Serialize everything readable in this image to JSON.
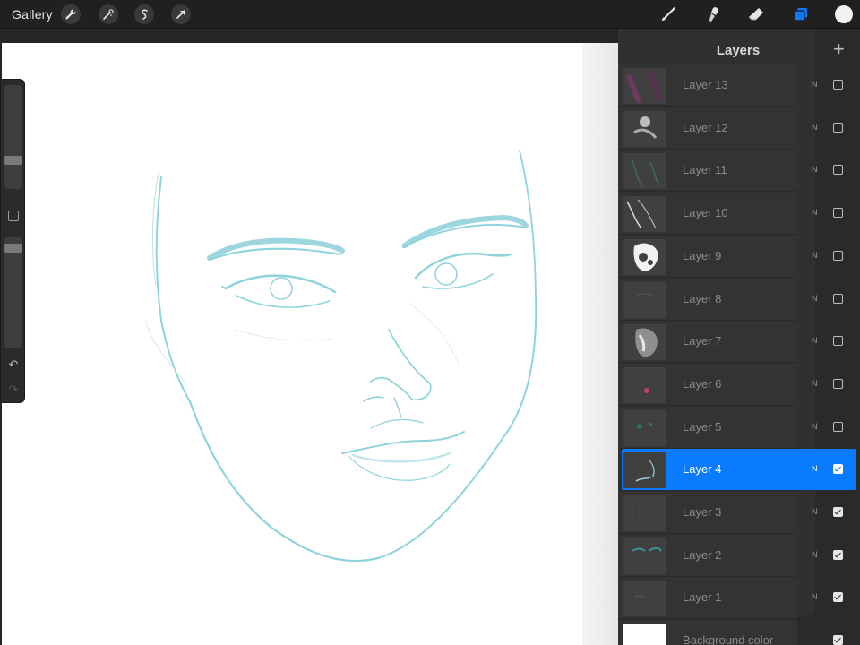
{
  "toolbar": {
    "gallery_label": "Gallery",
    "left_tools": [
      {
        "name": "actions-wrench-icon"
      },
      {
        "name": "adjustments-wand-icon"
      },
      {
        "name": "selection-icon"
      },
      {
        "name": "transform-arrow-icon"
      }
    ],
    "right_tools": [
      {
        "name": "brush-icon"
      },
      {
        "name": "smudge-icon"
      },
      {
        "name": "eraser-icon"
      },
      {
        "name": "layers-icon",
        "active": true,
        "color": "#0a7aff"
      }
    ],
    "current_color": "#f2f2f2"
  },
  "sidebar": {
    "undo_icon": "↶",
    "redo_icon": "↷"
  },
  "layers": {
    "title": "Layers",
    "add_icon": "+",
    "items": [
      {
        "name": "Layer 13",
        "blend": "N",
        "visible": false,
        "selected": false
      },
      {
        "name": "Layer 12",
        "blend": "N",
        "visible": false,
        "selected": false
      },
      {
        "name": "Layer 11",
        "blend": "N",
        "visible": false,
        "selected": false
      },
      {
        "name": "Layer 10",
        "blend": "N",
        "visible": false,
        "selected": false
      },
      {
        "name": "Layer 9",
        "blend": "N",
        "visible": false,
        "selected": false
      },
      {
        "name": "Layer 8",
        "blend": "N",
        "visible": false,
        "selected": false
      },
      {
        "name": "Layer 7",
        "blend": "N",
        "visible": false,
        "selected": false
      },
      {
        "name": "Layer 6",
        "blend": "N",
        "visible": false,
        "selected": false
      },
      {
        "name": "Layer 5",
        "blend": "N",
        "visible": false,
        "selected": false
      },
      {
        "name": "Layer 4",
        "blend": "N",
        "visible": true,
        "selected": true
      },
      {
        "name": "Layer 3",
        "blend": "N",
        "visible": true,
        "selected": false
      },
      {
        "name": "Layer 2",
        "blend": "N",
        "visible": true,
        "selected": false
      },
      {
        "name": "Layer 1",
        "blend": "N",
        "visible": true,
        "selected": false
      }
    ],
    "background": {
      "name": "Background color",
      "visible": true
    }
  },
  "colors": {
    "accent": "#0a7aff",
    "sketch_line": "#8fd3dc"
  }
}
